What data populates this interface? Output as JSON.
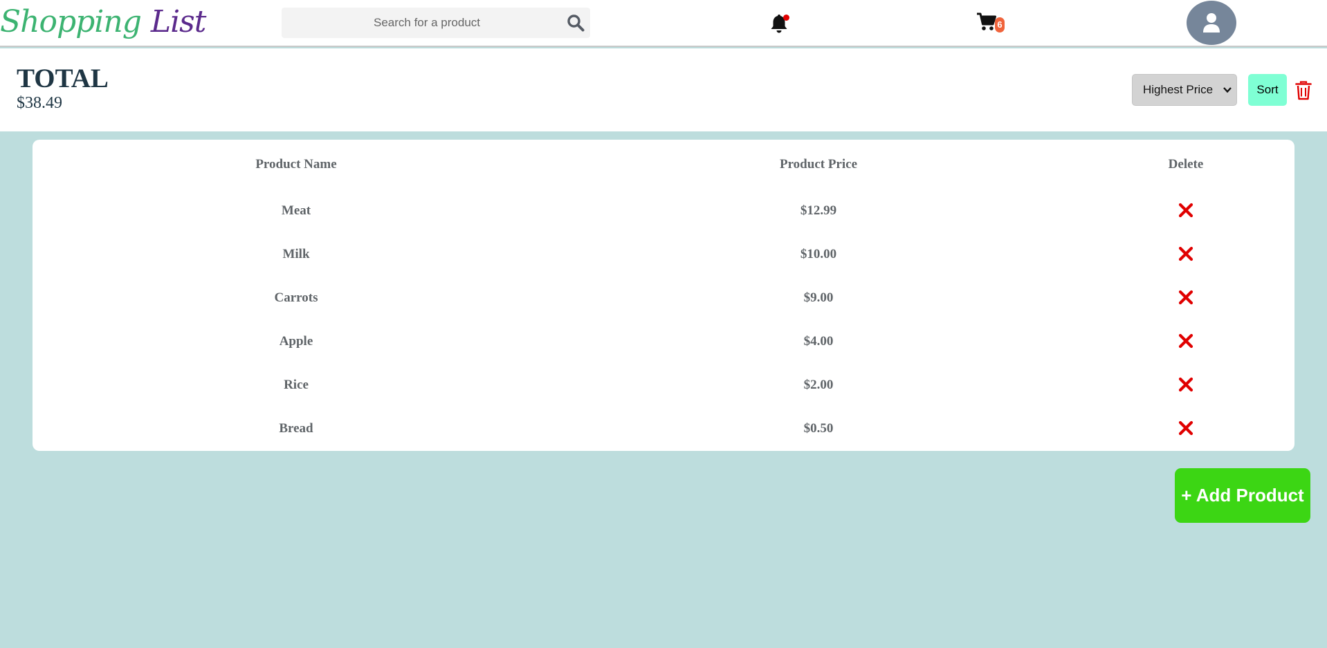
{
  "header": {
    "logo_word1": "Shopping",
    "logo_word2": "List",
    "search_placeholder": "Search for a product",
    "cart_count": "6",
    "icons": [
      "search-icon",
      "bell-icon",
      "cart-icon",
      "user-icon"
    ],
    "notification_dot_color": "#e00000"
  },
  "summary": {
    "title": "TOTAL",
    "amount": "$38.49",
    "sort_selected": "Highest Price",
    "sort_label": "Sort"
  },
  "table": {
    "headers": [
      "Product Name",
      "Product Price",
      "Delete"
    ],
    "rows": [
      {
        "name": "Meat",
        "price": "$12.99"
      },
      {
        "name": "Milk",
        "price": "$10.00"
      },
      {
        "name": "Carrots",
        "price": "$9.00"
      },
      {
        "name": "Apple",
        "price": "$4.00"
      },
      {
        "name": "Rice",
        "price": "$2.00"
      },
      {
        "name": "Bread",
        "price": "$0.50"
      }
    ]
  },
  "actions": {
    "add_label": "+ Add Product"
  },
  "colors": {
    "background": "#bddddd",
    "logo_green": "#3cb371",
    "logo_purple": "#5b2a8c",
    "sort_button": "#7fffd4",
    "add_button": "#3cd614",
    "delete_red": "#e00000",
    "cart_badge": "#f0643c"
  }
}
